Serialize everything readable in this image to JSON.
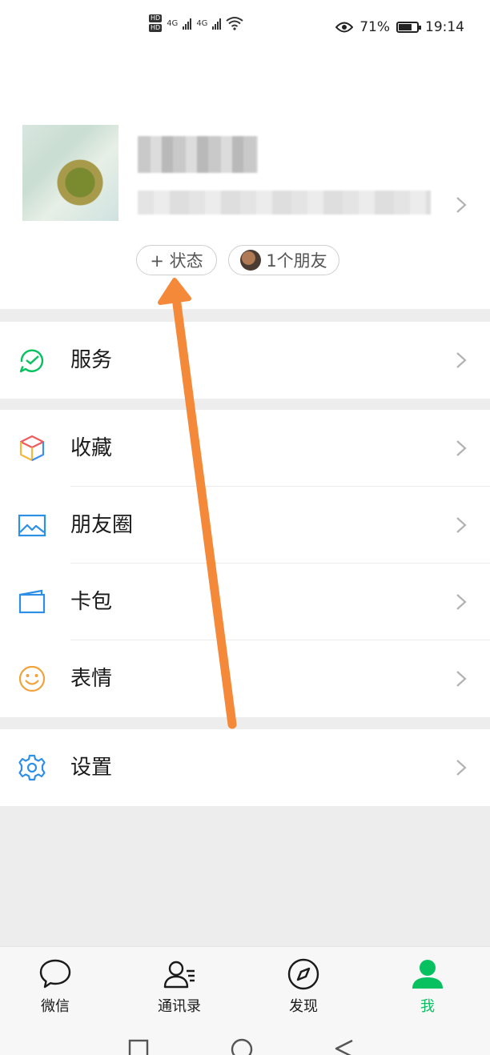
{
  "status_bar": {
    "network_1": "HD",
    "network_2": "HD",
    "sig_1": "4G",
    "sig_2": "4G",
    "battery": "71%",
    "time": "19:14"
  },
  "profile": {
    "status_chip": "+ 状态",
    "friends_chip": "1个朋友"
  },
  "menu": {
    "services": "服务",
    "favorites": "收藏",
    "moments": "朋友圈",
    "cards": "卡包",
    "stickers": "表情",
    "settings": "设置"
  },
  "tabs": {
    "chats": "微信",
    "contacts": "通讯录",
    "discover": "发现",
    "me": "我"
  },
  "colors": {
    "accent": "#07c160",
    "annotation_arrow": "#f5893a"
  }
}
